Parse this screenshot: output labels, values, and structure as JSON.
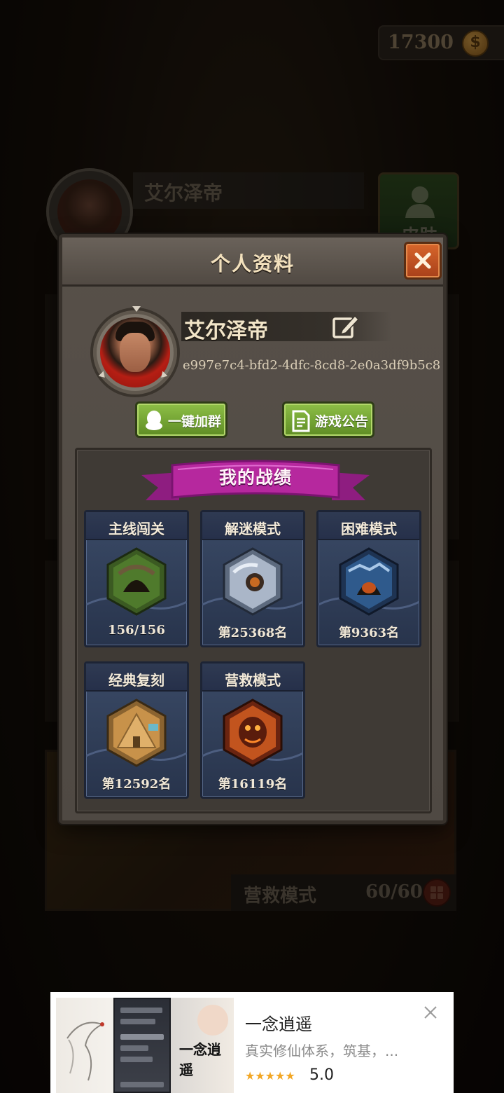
{
  "currency": {
    "amount": "17300",
    "icon": "dollar-coin-icon",
    "symbol": "$"
  },
  "background": {
    "player_name": "艾尔泽帝",
    "skin_button_label": "皮肤",
    "rescue_mode_label": "营救模式",
    "rescue_mode_count": "60/60"
  },
  "profile_modal": {
    "title": "个人资料",
    "player_name": "艾尔泽帝",
    "player_id": "e997e7c4-bfd2-4dfc-8cd8-2e0a3df9b5c8",
    "buttons": {
      "join_group": "一键加群",
      "game_notice": "游戏公告"
    },
    "stats": {
      "title": "我的战绩",
      "modes": [
        {
          "name": "主线闯关",
          "value": "156/156",
          "color": "#4f7a2c"
        },
        {
          "name": "解迷模式",
          "value": "第25368名",
          "color": "#aab6c8"
        },
        {
          "name": "困难模式",
          "value": "第9363名",
          "color": "#2f5a8c"
        },
        {
          "name": "经典复刻",
          "value": "第12592名",
          "color": "#c8924a"
        },
        {
          "name": "营救模式",
          "value": "第16119名",
          "color": "#c2541e"
        }
      ]
    }
  },
  "ad": {
    "title": "一念逍遥",
    "description": "真实修仙体系，筑基，...",
    "rating": "5.0",
    "stars": "★★★★★",
    "logo_text": "一念逍遥"
  },
  "colors": {
    "accent_green": "#6fa32f",
    "close_orange": "#c8542a",
    "banner_magenta": "#b0269e",
    "card_blue": "#2f3c58"
  }
}
